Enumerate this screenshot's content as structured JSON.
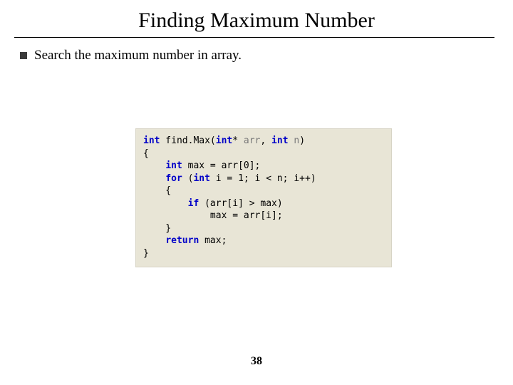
{
  "title": "Finding Maximum Number",
  "bullet_text": "Search the maximum number in array.",
  "code": {
    "l1a": "int",
    "l1b": " find.Max(",
    "l1c": "int",
    "l1d": "*",
    "l1e": " arr",
    "l1f": ", ",
    "l1g": "int",
    "l1h": " n",
    "l1i": ")",
    "l2": "{",
    "l3a": "    ",
    "l3b": "int",
    "l3c": " max = arr[0];",
    "l4a": "    ",
    "l4b": "for",
    "l4c": " (",
    "l4d": "int",
    "l4e": " i = 1; i < n; i++)",
    "l5": "    {",
    "l6a": "        ",
    "l6b": "if",
    "l6c": " (arr[i] > max)",
    "l7": "            max = arr[i];",
    "l8": "    }",
    "l9a": "    ",
    "l9b": "return",
    "l9c": " max;",
    "l10": "}"
  },
  "page_number": "38"
}
